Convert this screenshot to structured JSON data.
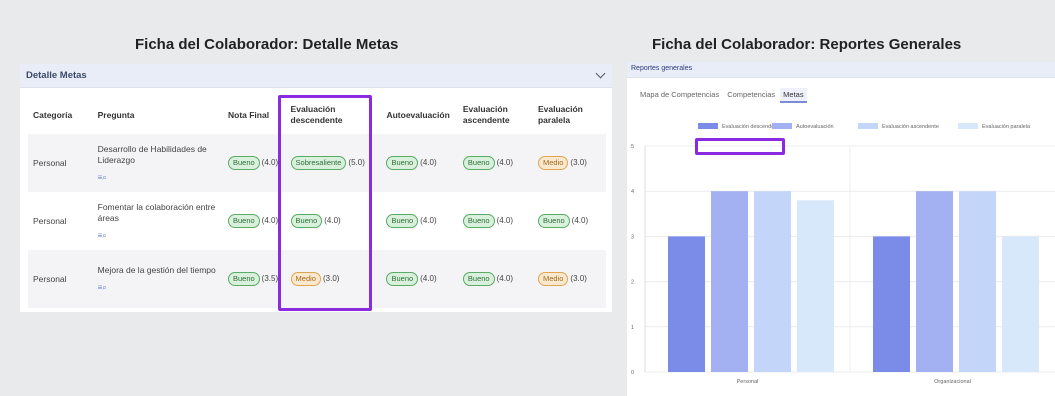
{
  "left": {
    "title": "Ficha del Colaborador: Detalle Metas",
    "panel_title": "Detalle Metas",
    "columns": [
      "Categoría",
      "Pregunta",
      "Nota Final",
      "Evaluación descendente",
      "Autoevaluación",
      "Evaluación ascendente",
      "Evaluación paralela"
    ],
    "rows": [
      {
        "categoria": "Personal",
        "pregunta": "Desarrollo de Habilidades de Liderazgo",
        "nota_final": {
          "badge": "Bueno",
          "score": "(4.0)"
        },
        "descendente": {
          "badge": "Sobresaliente",
          "score": "(5.0)"
        },
        "auto": {
          "badge": "Bueno",
          "score": "(4.0)"
        },
        "ascendente": {
          "badge": "Bueno",
          "score": "(4.0)"
        },
        "paralela": {
          "badge": "Medio",
          "score": "(3.0)"
        }
      },
      {
        "categoria": "Personal",
        "pregunta": "Fomentar la colaboración entre áreas",
        "nota_final": {
          "badge": "Bueno",
          "score": "(4.0)"
        },
        "descendente": {
          "badge": "Bueno",
          "score": "(4.0)"
        },
        "auto": {
          "badge": "Bueno",
          "score": "(4.0)"
        },
        "ascendente": {
          "badge": "Bueno",
          "score": "(4.0)"
        },
        "paralela": {
          "badge": "Bueno",
          "score": "(4.0)"
        }
      },
      {
        "categoria": "Personal",
        "pregunta": "Mejora de la gestión del tiempo",
        "nota_final": {
          "badge": "Bueno",
          "score": "(3.5)"
        },
        "descendente": {
          "badge": "Medio",
          "score": "(3.0)"
        },
        "auto": {
          "badge": "Bueno",
          "score": "(4.0)"
        },
        "ascendente": {
          "badge": "Bueno",
          "score": "(4.0)"
        },
        "paralela": {
          "badge": "Medio",
          "score": "(3.0)"
        }
      }
    ],
    "badge_colors": {
      "Bueno": "green",
      "Sobresaliente": "green",
      "Medio": "orange"
    },
    "icon": "list-search-icon"
  },
  "right": {
    "title": "Ficha del Colaborador: Reportes Generales",
    "panel_title": "Reportes generales",
    "tabs": [
      "Mapa de Competencias",
      "Competencias",
      "Metas"
    ],
    "active_tab": "Metas"
  },
  "chart_data": {
    "type": "bar",
    "categories": [
      "Personal",
      "Organizacional"
    ],
    "series": [
      {
        "name": "Evaluación descendente",
        "values": [
          3.0,
          3.0
        ],
        "color": "#7b8be8"
      },
      {
        "name": "Autoevaluación",
        "values": [
          4.0,
          4.0
        ],
        "color": "#a3b0f2"
      },
      {
        "name": "Evaluación ascendente",
        "values": [
          4.0,
          4.0
        ],
        "color": "#c3d6f9"
      },
      {
        "name": "Evaluación paralela",
        "values": [
          3.8,
          3.0
        ],
        "color": "#d8e8fb"
      }
    ],
    "ylim": [
      0,
      5
    ],
    "yticks": [
      0,
      1,
      2,
      3,
      4,
      5
    ],
    "legend": "top"
  }
}
